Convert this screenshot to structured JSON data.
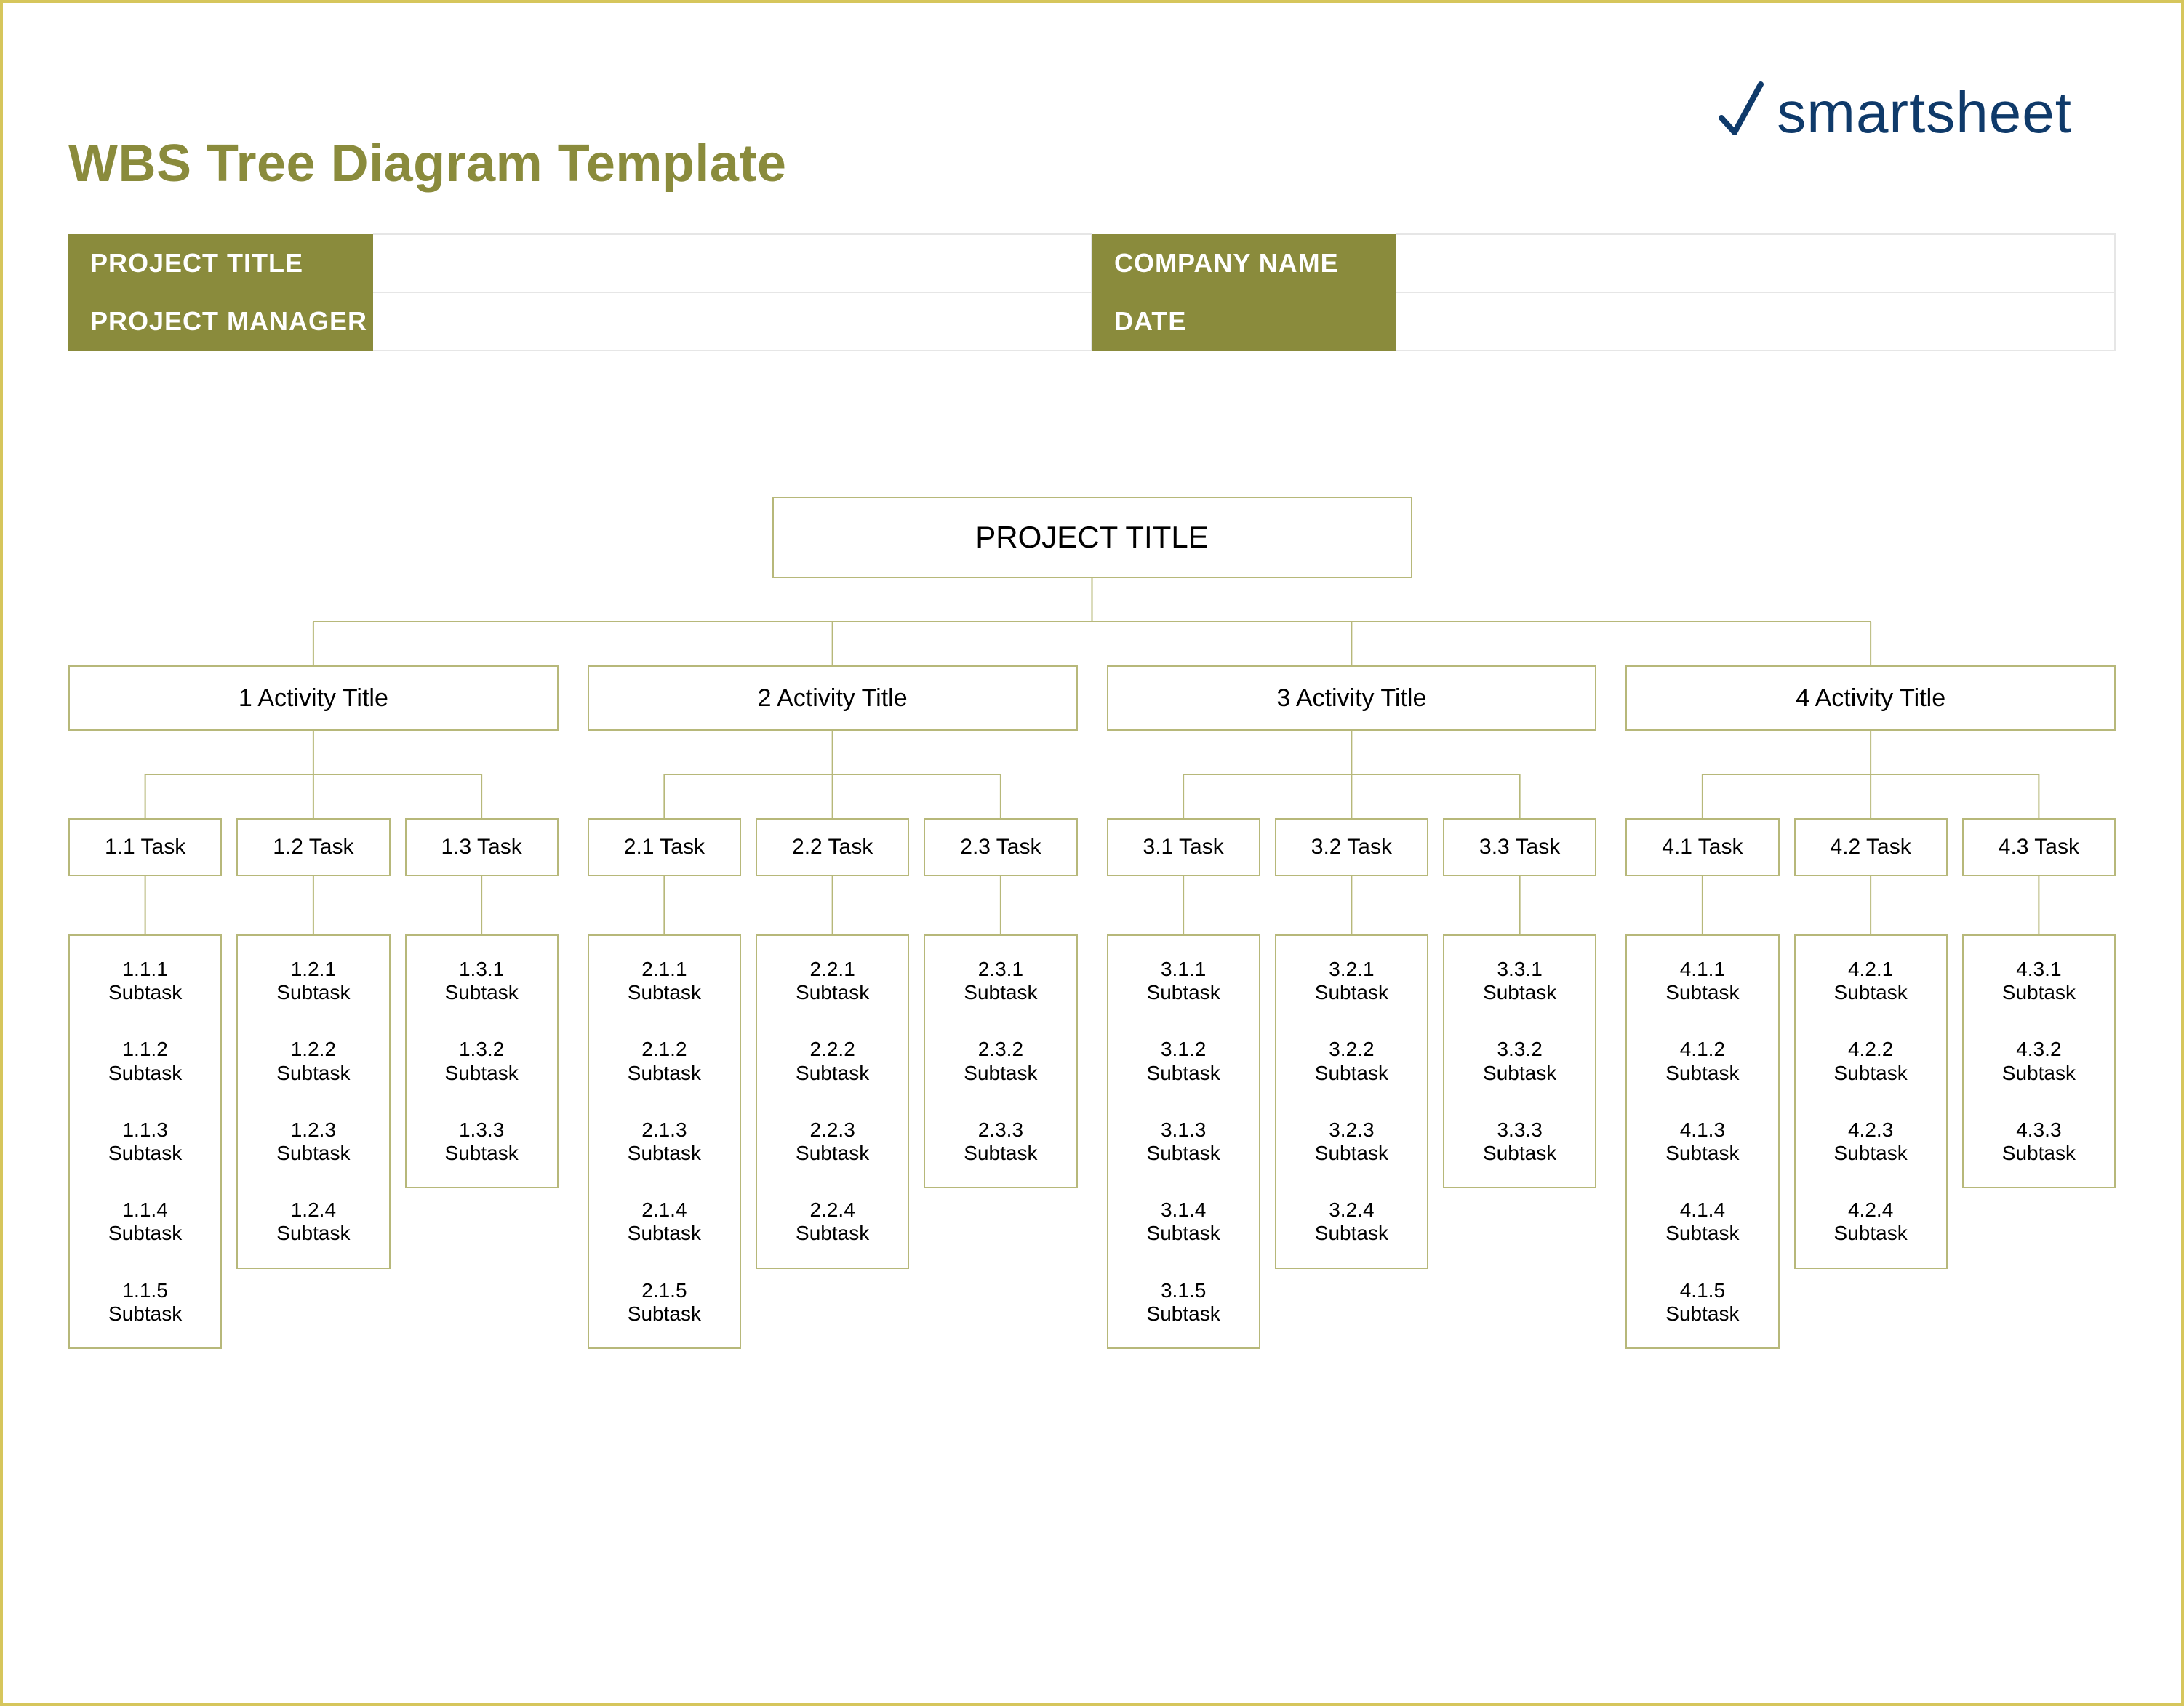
{
  "brand": {
    "text": "smartsheet"
  },
  "doc_title": "WBS Tree Diagram Template",
  "meta": {
    "project_title_label": "PROJECT TITLE",
    "company_name_label": "COMPANY NAME",
    "project_manager_label": "PROJECT MANAGER",
    "date_label": "DATE",
    "project_title_value": "",
    "company_name_value": "",
    "project_manager_value": "",
    "date_value": ""
  },
  "root_label": "PROJECT TITLE",
  "activities": [
    {
      "label": "1 Activity Title",
      "tasks": [
        {
          "label": "1.1 Task",
          "subtasks": [
            "1.1.1 Subtask",
            "1.1.2 Subtask",
            "1.1.3 Subtask",
            "1.1.4 Subtask",
            "1.1.5 Subtask"
          ]
        },
        {
          "label": "1.2 Task",
          "subtasks": [
            "1.2.1 Subtask",
            "1.2.2 Subtask",
            "1.2.3 Subtask",
            "1.2.4 Subtask"
          ]
        },
        {
          "label": "1.3 Task",
          "subtasks": [
            "1.3.1 Subtask",
            "1.3.2 Subtask",
            "1.3.3 Subtask"
          ]
        }
      ]
    },
    {
      "label": "2 Activity Title",
      "tasks": [
        {
          "label": "2.1 Task",
          "subtasks": [
            "2.1.1 Subtask",
            "2.1.2 Subtask",
            "2.1.3 Subtask",
            "2.1.4 Subtask",
            "2.1.5 Subtask"
          ]
        },
        {
          "label": "2.2 Task",
          "subtasks": [
            "2.2.1 Subtask",
            "2.2.2 Subtask",
            "2.2.3 Subtask",
            "2.2.4 Subtask"
          ]
        },
        {
          "label": "2.3 Task",
          "subtasks": [
            "2.3.1 Subtask",
            "2.3.2 Subtask",
            "2.3.3 Subtask"
          ]
        }
      ]
    },
    {
      "label": "3 Activity Title",
      "tasks": [
        {
          "label": "3.1 Task",
          "subtasks": [
            "3.1.1 Subtask",
            "3.1.2 Subtask",
            "3.1.3 Subtask",
            "3.1.4 Subtask",
            "3.1.5 Subtask"
          ]
        },
        {
          "label": "3.2 Task",
          "subtasks": [
            "3.2.1 Subtask",
            "3.2.2 Subtask",
            "3.2.3 Subtask",
            "3.2.4 Subtask"
          ]
        },
        {
          "label": "3.3 Task",
          "subtasks": [
            "3.3.1 Subtask",
            "3.3.2 Subtask",
            "3.3.3 Subtask"
          ]
        }
      ]
    },
    {
      "label": "4 Activity Title",
      "tasks": [
        {
          "label": "4.1 Task",
          "subtasks": [
            "4.1.1 Subtask",
            "4.1.2 Subtask",
            "4.1.3 Subtask",
            "4.1.4 Subtask",
            "4.1.5 Subtask"
          ]
        },
        {
          "label": "4.2 Task",
          "subtasks": [
            "4.2.1 Subtask",
            "4.2.2 Subtask",
            "4.2.3 Subtask",
            "4.2.4 Subtask"
          ]
        },
        {
          "label": "4.3 Task",
          "subtasks": [
            "4.3.1 Subtask",
            "4.3.2 Subtask",
            "4.3.3 Subtask"
          ]
        }
      ]
    }
  ]
}
